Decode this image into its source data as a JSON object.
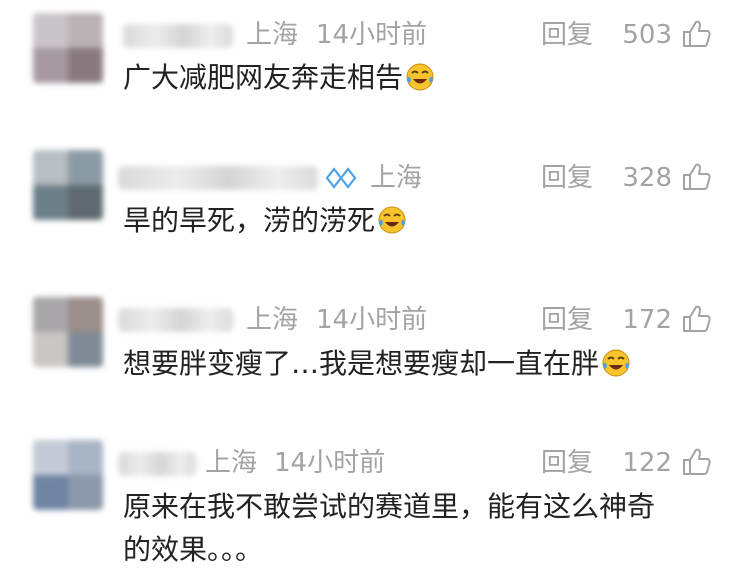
{
  "comments": [
    {
      "location": "上海",
      "time": "14小时前",
      "reply_label": "回复",
      "likes": "503",
      "text": "广大减肥网友奔走相告",
      "emoji": "laughing-crying-emoji"
    },
    {
      "location": "上海",
      "time": "",
      "verified_icon": "verified-badge-icon",
      "reply_label": "回复",
      "likes": "328",
      "text": "旱的旱死，涝的涝死",
      "emoji": "laughing-crying-emoji"
    },
    {
      "location": "上海",
      "time": "14小时前",
      "reply_label": "回复",
      "likes": "172",
      "text": "想要胖变瘦了…我是想要瘦却一直在胖",
      "emoji": "laughing-crying-emoji"
    },
    {
      "location": "上海",
      "time": "14小时前",
      "reply_label": "回复",
      "likes": "122",
      "text_line1": "原来在我不敢尝试的赛道里，能有这么神奇",
      "text_line2": "的效果。。。"
    }
  ],
  "colors": {
    "meta_text": "#a3a3a3",
    "body_text": "#222222",
    "verified_blue": "#4aa3e8"
  }
}
